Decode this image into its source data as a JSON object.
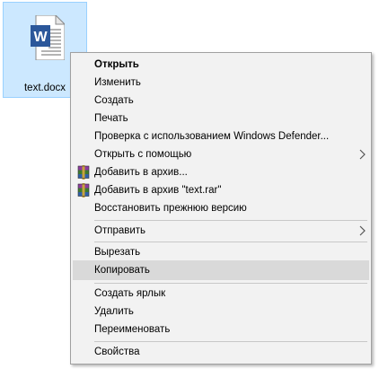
{
  "file": {
    "name": "text.docx",
    "icon": "word-document-icon",
    "icon_color": "#2b579a"
  },
  "context_menu": {
    "items": [
      {
        "label": "Открыть",
        "bold": true
      },
      {
        "label": "Изменить"
      },
      {
        "label": "Создать"
      },
      {
        "label": "Печать"
      },
      {
        "label": "Проверка с использованием Windows Defender..."
      },
      {
        "label": "Открыть с помощью",
        "submenu": true
      },
      {
        "label": "Добавить в архив...",
        "icon": "winrar-icon"
      },
      {
        "label": "Добавить в архив \"text.rar\"",
        "icon": "winrar-icon"
      },
      {
        "label": "Восстановить прежнюю версию"
      },
      {
        "label": "Отправить",
        "submenu": true
      },
      {
        "label": "Вырезать"
      },
      {
        "label": "Копировать",
        "highlighted": true
      },
      {
        "label": "Создать ярлык"
      },
      {
        "label": "Удалить"
      },
      {
        "label": "Переименовать"
      },
      {
        "label": "Свойства"
      }
    ],
    "highlight_color": "#d9d9d9",
    "background_color": "#f2f2f2"
  }
}
